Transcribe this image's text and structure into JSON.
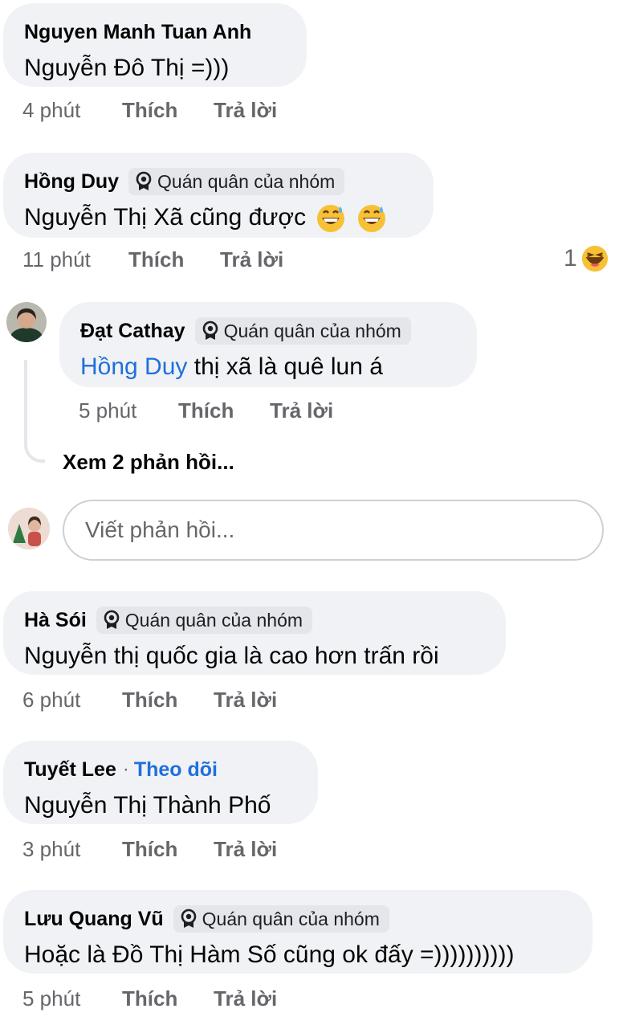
{
  "comments": [
    {
      "author": "Nguyen Manh Tuan Anh",
      "text": "Nguyễn Đô Thị =)))",
      "time": "4 phút",
      "like_label": "Thích",
      "reply_label": "Trả lời"
    },
    {
      "author": "Hồng Duy",
      "badge": "Quán quân của nhóm",
      "text": "Nguyễn Thị Xã cũng được",
      "time": "11 phút",
      "like_label": "Thích",
      "reply_label": "Trả lời",
      "reaction_count": "1",
      "replies": [
        {
          "author": "Đạt Cathay",
          "badge": "Quán quân của nhóm",
          "mention": "Hồng Duy",
          "text": "thị xã là quê lun á",
          "time": "5 phút",
          "like_label": "Thích",
          "reply_label": "Trả lời"
        }
      ],
      "view_replies": "Xem 2 phản hồi...",
      "reply_placeholder": "Viết phản hồi..."
    },
    {
      "author": "Hà Sói",
      "badge": "Quán quân của nhóm",
      "text": "Nguyễn thị quốc gia là cao hơn trấn rồi",
      "time": "6 phút",
      "like_label": "Thích",
      "reply_label": "Trả lời"
    },
    {
      "author": "Tuyết Lee",
      "follow_sep": "·",
      "follow": "Theo dõi",
      "text": "Nguyễn Thị Thành Phố",
      "time": "3 phút",
      "like_label": "Thích",
      "reply_label": "Trả lời"
    },
    {
      "author": "Lưu Quang Vũ",
      "badge": "Quán quân của nhóm",
      "text": "Hoặc là Đồ Thị Hàm Số cũng ok đấy =))))))))))",
      "time": "5 phút",
      "like_label": "Thích",
      "reply_label": "Trả lời"
    }
  ],
  "colors": {
    "bubble": "#f0f2f5",
    "badge": "#e4e6eb",
    "link": "#216fdb",
    "muted": "#65676b"
  },
  "icons": [
    "champion-badge-icon",
    "grinning-sweat-emoji",
    "laughing-emoji"
  ]
}
